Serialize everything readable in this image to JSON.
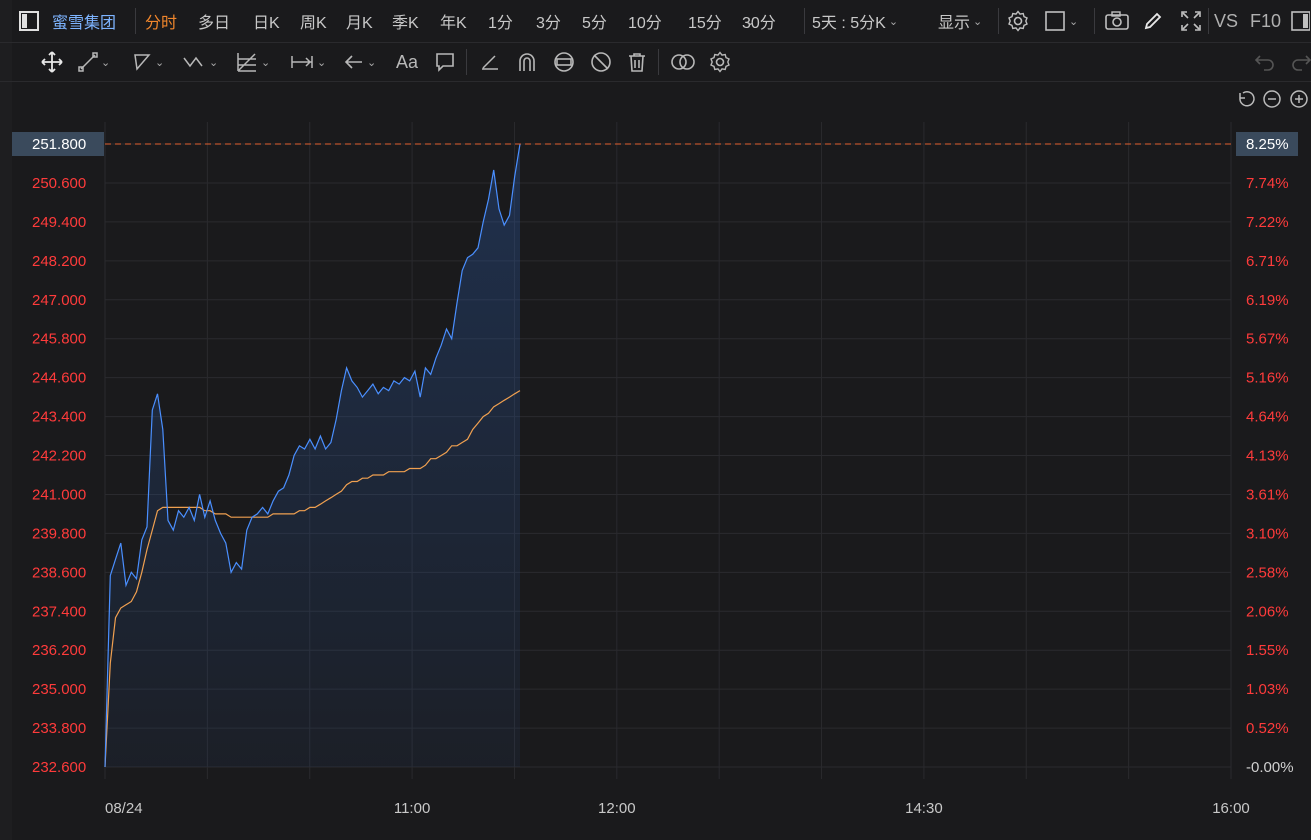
{
  "toolbar": {
    "stock_name": "蜜雪集团",
    "periods": [
      {
        "label": "分时",
        "active": true
      },
      {
        "label": "多日",
        "active": false
      },
      {
        "label": "日K",
        "active": false
      },
      {
        "label": "周K",
        "active": false
      },
      {
        "label": "月K",
        "active": false
      },
      {
        "label": "季K",
        "active": false
      },
      {
        "label": "年K",
        "active": false
      },
      {
        "label": "1分",
        "active": false
      },
      {
        "label": "3分",
        "active": false
      },
      {
        "label": "5分",
        "active": false
      },
      {
        "label": "10分",
        "active": false
      },
      {
        "label": "15分",
        "active": false
      },
      {
        "label": "30分",
        "active": false
      }
    ],
    "multi_day_select": "5天 : 5分K",
    "display_label": "显示",
    "vs_label": "VS",
    "f10_label": "F10"
  },
  "drawing_tools": [
    "move-tool-icon",
    "line-tool-icon",
    "shape-tool-icon",
    "wave-tool-icon",
    "fib-tool-icon",
    "measure-tool-icon",
    "arrow-tool-icon",
    "text-tool-icon",
    "comment-tool-icon",
    "ruler-icon",
    "magnet-icon",
    "lock-icon",
    "hide-icon",
    "trash-icon",
    "compare-icon",
    "settings-icon"
  ],
  "colors": {
    "background": "#1a1a1c",
    "price_line": "#4a8fff",
    "avg_line": "#f0a050",
    "axis_text": "#ff3b3b",
    "zero_text": "#d0d0d0",
    "highlight_bg": "#3a4a5c",
    "ref_line": "#e06030"
  },
  "chart_data": {
    "type": "line",
    "title": "",
    "y_left_ticks": [
      "251.800",
      "250.600",
      "249.400",
      "248.200",
      "247.000",
      "245.800",
      "244.600",
      "243.400",
      "242.200",
      "241.000",
      "239.800",
      "238.600",
      "237.400",
      "236.200",
      "235.000",
      "233.800",
      "232.600"
    ],
    "y_right_ticks": [
      "8.25%",
      "7.74%",
      "7.22%",
      "6.71%",
      "6.19%",
      "5.67%",
      "5.16%",
      "4.64%",
      "4.13%",
      "3.61%",
      "3.10%",
      "2.58%",
      "2.06%",
      "1.55%",
      "1.03%",
      "0.52%",
      "-0.00%"
    ],
    "x_ticks": [
      "08/24",
      "11:00",
      "12:00",
      "14:30",
      "16:00"
    ],
    "ylim": [
      232.6,
      251.8
    ],
    "current_price": "251.800",
    "current_pct": "8.25%",
    "series": [
      {
        "values": [
          232.6,
          238.5,
          239.0,
          239.5,
          238.2,
          238.6,
          238.4,
          239.6,
          240.0,
          243.6,
          244.1,
          243.0,
          240.2,
          239.9,
          240.5,
          240.3,
          240.6,
          240.2,
          241.0,
          240.3,
          240.8,
          240.2,
          239.8,
          239.5,
          238.6,
          238.9,
          238.7,
          239.9,
          240.3,
          240.4,
          240.6,
          240.4,
          240.8,
          241.1,
          241.2,
          241.6,
          242.2,
          242.5,
          242.4,
          242.7,
          242.4,
          242.8,
          242.4,
          242.6,
          243.3,
          244.2,
          244.9,
          244.5,
          244.3,
          244.0,
          244.2,
          244.4,
          244.1,
          244.3,
          244.2,
          244.5,
          244.4,
          244.6,
          244.5,
          244.8,
          244.0,
          244.9,
          244.7,
          245.2,
          245.6,
          246.1,
          245.8,
          246.9,
          247.9,
          248.3,
          248.4,
          248.6,
          249.4,
          250.1,
          251.0,
          249.8,
          249.3,
          249.6,
          250.8,
          251.8
        ]
      },
      {
        "values": [
          232.6,
          235.8,
          237.2,
          237.5,
          237.6,
          237.7,
          238.0,
          238.6,
          239.3,
          239.9,
          240.5,
          240.6,
          240.6,
          240.6,
          240.6,
          240.6,
          240.6,
          240.6,
          240.6,
          240.5,
          240.5,
          240.4,
          240.4,
          240.4,
          240.3,
          240.3,
          240.3,
          240.3,
          240.3,
          240.3,
          240.3,
          240.3,
          240.4,
          240.4,
          240.4,
          240.4,
          240.4,
          240.5,
          240.5,
          240.6,
          240.6,
          240.7,
          240.8,
          240.9,
          241.0,
          241.1,
          241.3,
          241.4,
          241.4,
          241.5,
          241.5,
          241.6,
          241.6,
          241.6,
          241.7,
          241.7,
          241.7,
          241.7,
          241.8,
          241.8,
          241.8,
          241.9,
          242.1,
          242.1,
          242.2,
          242.3,
          242.5,
          242.5,
          242.6,
          242.7,
          243.0,
          243.2,
          243.4,
          243.5,
          243.7,
          243.8,
          243.9,
          244.0,
          244.1,
          244.2
        ]
      }
    ],
    "grid": true
  }
}
